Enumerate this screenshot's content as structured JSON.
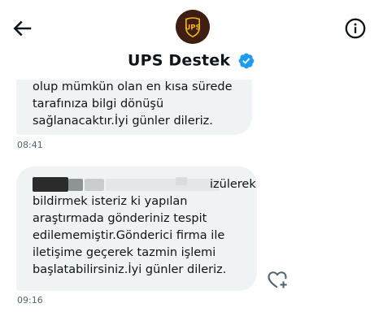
{
  "header": {
    "display_name": "UPS Destek",
    "avatar_logo_text": "UPS",
    "back_icon": "arrow-left-icon",
    "info_icon": "info-icon",
    "verified_icon": "verified-badge-icon"
  },
  "messages": [
    {
      "text": "olup mümkün olan en kısa sürede\ntarafınıza bilgi dönüşü\nsağlanacaktır.İyi günler dileriz.",
      "time": "08:41"
    },
    {
      "text": "izülerek\nbildirmek isteriz ki yapılan\naraştırmada gönderiniz tespit\nedilememiştir.Gönderici firma ile\niletişime geçerek tazmin işlemi\nbaşlatabilirsiniz.İyi günler dileriz.",
      "time": "09:16"
    }
  ],
  "colors": {
    "bubble": "#eff3f4",
    "verified": "#1d9bf0",
    "ups_brown": "#3e1e10",
    "ups_gold": "#f5b21a",
    "timestamp": "#536471",
    "text": "#0f1419"
  },
  "react_icon": "heart-plus-icon"
}
